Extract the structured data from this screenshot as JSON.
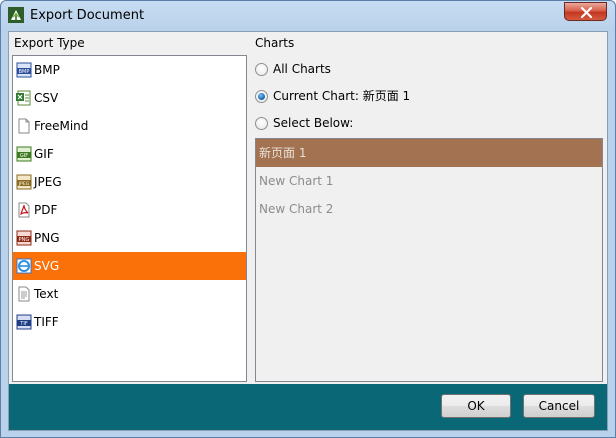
{
  "window": {
    "title": "Export Document"
  },
  "export_type": {
    "label": "Export Type",
    "items": [
      {
        "label": "BMP",
        "icon": "bmp-file-icon",
        "selected": false
      },
      {
        "label": "CSV",
        "icon": "csv-file-icon",
        "selected": false
      },
      {
        "label": "FreeMind",
        "icon": "blank-file-icon",
        "selected": false
      },
      {
        "label": "GIF",
        "icon": "gif-file-icon",
        "selected": false
      },
      {
        "label": "JPEG",
        "icon": "jpeg-file-icon",
        "selected": false
      },
      {
        "label": "PDF",
        "icon": "pdf-file-icon",
        "selected": false
      },
      {
        "label": "PNG",
        "icon": "png-file-icon",
        "selected": false
      },
      {
        "label": "SVG",
        "icon": "svg-file-icon",
        "selected": true
      },
      {
        "label": "Text",
        "icon": "text-file-icon",
        "selected": false
      },
      {
        "label": "TIFF",
        "icon": "tiff-file-icon",
        "selected": false
      }
    ],
    "selected_color": "#fb7109"
  },
  "charts": {
    "label": "Charts",
    "options": {
      "all": "All Charts",
      "current": "Current Chart: 新页面 1",
      "select_below": "Select Below:"
    },
    "checked_option": "current",
    "list": [
      {
        "label": "新页面 1",
        "selected": true
      },
      {
        "label": "New Chart 1",
        "selected": false
      },
      {
        "label": "New Chart 2",
        "selected": false
      }
    ],
    "selected_color": "#a37250"
  },
  "buttons": {
    "ok": "OK",
    "cancel": "Cancel"
  },
  "colors": {
    "bottom_bar": "#0a6775",
    "title_bar": "#b9d1ea"
  }
}
